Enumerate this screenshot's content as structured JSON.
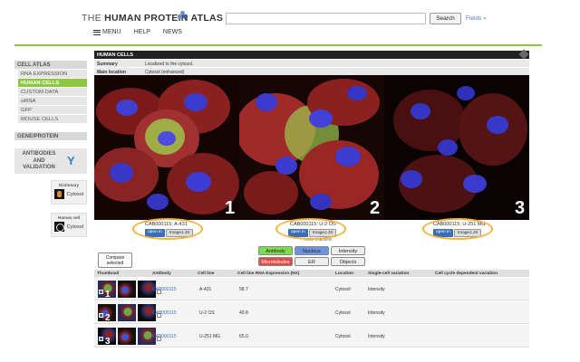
{
  "header": {
    "logo_prefix": "THE",
    "logo_main": "HUMAN PROTEIN ATLAS",
    "nav": [
      "MENU",
      "HELP",
      "NEWS"
    ],
    "search_placeholder": "",
    "search_button": "Search",
    "fields_link": "Fields »"
  },
  "sidebar": {
    "section1": "CELL ATLAS",
    "items": [
      "RNA EXPRESSION",
      "HUMAN CELLS",
      "CUSTOM DATA",
      "siRNA",
      "GFP",
      "MOUSE CELLS"
    ],
    "active_item": "HUMAN CELLS",
    "section2": "GENE/PROTEIN",
    "antibodies_label": "ANTIBODIES AND VALIDATION",
    "dictionary_title": "Dictionary",
    "dictionary_label": "Cytosol",
    "humancell_title": "Human cell",
    "humancell_label": "Cytosol"
  },
  "panel": {
    "title": "HUMAN CELLS",
    "summary_label": "Summary",
    "summary_value": "Localized to the cytosol.",
    "location_label": "Main location",
    "location_value": "Cytosol (enhanced)"
  },
  "images": [
    {
      "caption": "CAB000115; A-431",
      "number": "1"
    },
    {
      "caption": "CAB000115; U-2 OS",
      "number": "2"
    },
    {
      "caption": "CAB000115; U-251 MG",
      "number": "3"
    }
  ],
  "image_buttons": {
    "open": "open in",
    "imagej": "ImageJ.JS"
  },
  "channel_label": "Color channels",
  "channels": [
    {
      "label": "Antibody",
      "color": "#7ddb4f"
    },
    {
      "label": "Nucleus",
      "color": "#6f93e0"
    },
    {
      "label": "Intensity",
      "color": "#eeeeee"
    },
    {
      "label": "Microtubules",
      "color": "#e64848"
    },
    {
      "label": "ER",
      "color": "#eeeeee"
    },
    {
      "label": "Objects",
      "color": "#eeeeee"
    }
  ],
  "compare_button": "Compare selected",
  "table": {
    "headers": [
      "Thumbnail",
      "Antibody",
      "Cell line",
      "Cell line RNA Expression (NX)",
      "Location",
      "Single-cell variation",
      "Cell cycle dependent variation"
    ],
    "rows": [
      {
        "num": "1",
        "antibody": "CAB000115",
        "cell_line": "A-431",
        "rna": "58.7",
        "location": "Cytosol",
        "variation": "Intensity",
        "cycle": ""
      },
      {
        "num": "2",
        "antibody": "CAB000115",
        "cell_line": "U-2 OS",
        "rna": "49.8",
        "location": "Cytosol",
        "variation": "Intensity",
        "cycle": ""
      },
      {
        "num": "3",
        "antibody": "CAB000115",
        "cell_line": "U-251 MG",
        "rna": "65.0",
        "location": "Cytosol",
        "variation": "Intensity",
        "cycle": ""
      }
    ]
  },
  "colors": {
    "accent_green": "#8dc63f",
    "link_blue": "#3a6fb5",
    "highlight_oval": "#f4b43c"
  }
}
